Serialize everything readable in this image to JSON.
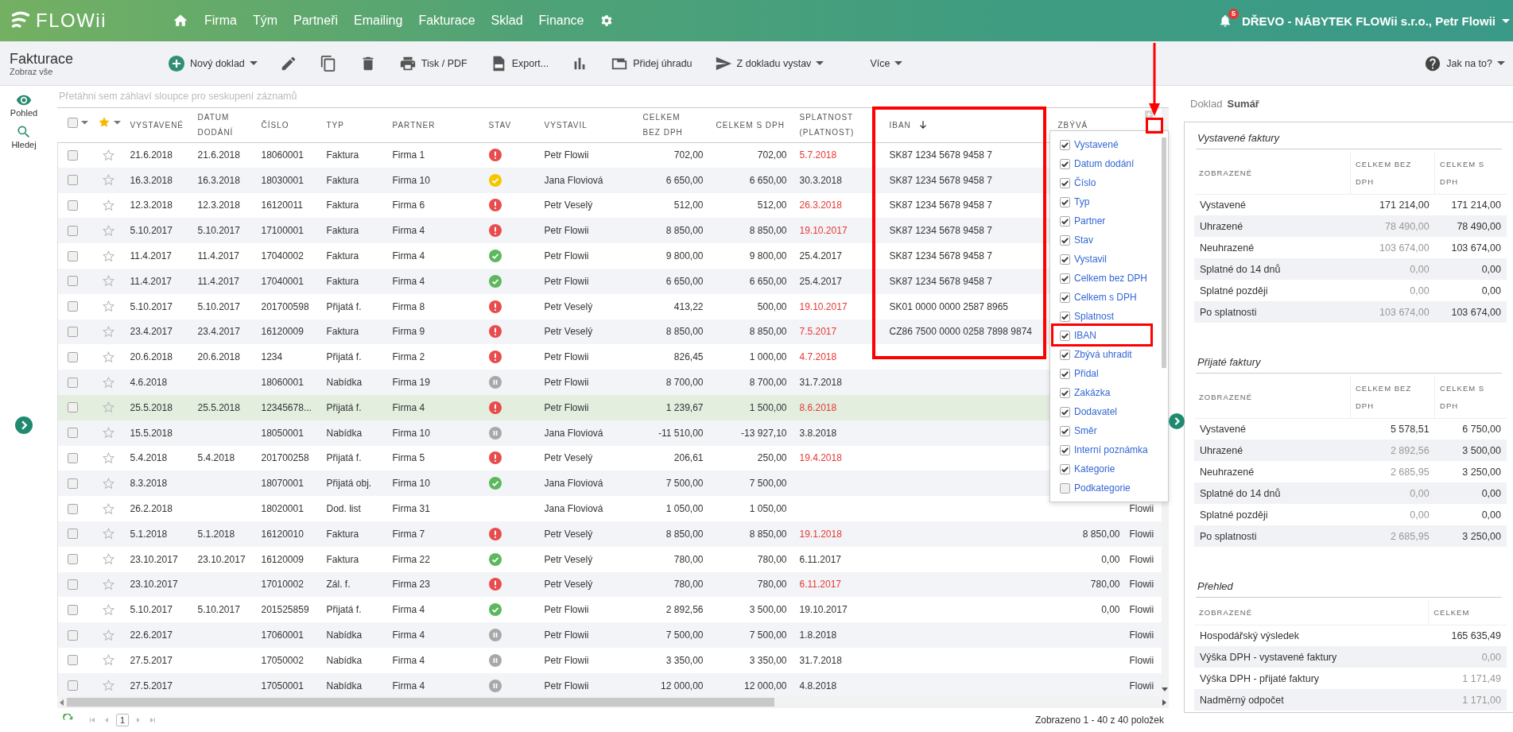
{
  "topbar": {
    "logo": "FLOWii",
    "nav": [
      "Firma",
      "Tým",
      "Partneři",
      "Emailing",
      "Fakturace",
      "Sklad",
      "Finance"
    ],
    "notifications": "5",
    "account": "DŘEVO - NÁBYTEK FLOWii s.r.o., Petr Flowii"
  },
  "toolbar": {
    "title": "Fakturace",
    "subtitle": "Zobraz vše",
    "actions": [
      {
        "kind": "new",
        "label": "Nový doklad",
        "dropdown": true
      },
      {
        "kind": "edit",
        "dropdown": false
      },
      {
        "kind": "copy",
        "dropdown": false
      },
      {
        "kind": "delete",
        "dropdown": false
      },
      {
        "kind": "print",
        "label": "Tisk / PDF",
        "dropdown": false
      },
      {
        "kind": "export",
        "label": "Export...",
        "dropdown": false
      },
      {
        "kind": "chart",
        "dropdown": false
      },
      {
        "kind": "payment",
        "label": "Přidej úhradu",
        "dropdown": false
      },
      {
        "kind": "issue",
        "label": "Z dokladu vystav",
        "dropdown": true
      },
      {
        "kind": "more",
        "label": "Více",
        "dropdown": true
      }
    ],
    "help": {
      "label": "Jak na to?",
      "dropdown": true
    }
  },
  "rail": [
    {
      "kind": "view",
      "label": "Pohled"
    },
    {
      "kind": "search",
      "label": "Hledej"
    }
  ],
  "grid": {
    "group_hint": "Přetáhni sem záhlaví sloupce pro seskupení záznamů",
    "columns": [
      {
        "kind": "check",
        "checked": false
      },
      {
        "kind": "star"
      },
      {
        "kind": "text",
        "label": "VYSTAVENÉ",
        "sorted": false
      },
      {
        "kind": "text",
        "label": "DATUM\nDODÁNÍ",
        "sorted": false
      },
      {
        "kind": "text",
        "label": "ČÍSLO",
        "sorted": false
      },
      {
        "kind": "text",
        "label": "TYP",
        "sorted": false
      },
      {
        "kind": "text",
        "label": "PARTNER",
        "sorted": false
      },
      {
        "kind": "status",
        "label": "STAV",
        "sorted": false
      },
      {
        "kind": "text",
        "label": "VYSTAVIL",
        "sorted": false
      },
      {
        "kind": "number",
        "label": "CELKEM\nBEZ DPH",
        "sorted": false
      },
      {
        "kind": "number",
        "label": "CELKEM S DPH",
        "sorted": false
      },
      {
        "kind": "due",
        "label": "SPLATNOST\n(PLATNOST)",
        "sorted": false
      },
      {
        "kind": "text",
        "label": "IBAN",
        "sorted": true
      },
      {
        "kind": "number",
        "label": "ZBÝVÁ",
        "sorted": false
      },
      {
        "kind": "text"
      }
    ],
    "rows": [
      {
        "checked": false,
        "selected": false,
        "issued": "21.6.2018",
        "delivered": "21.6.2018",
        "number": "18060001",
        "type": "Faktura",
        "partner": "Firma 1",
        "status": {
          "kind": "error"
        },
        "issued_by": "Petr Flowii",
        "net": "702,00",
        "gross": "702,00",
        "due": "5.7.2018",
        "overdue": true,
        "iban": "SK87 1234 5678 9458 7"
      },
      {
        "checked": false,
        "selected": false,
        "issued": "16.3.2018",
        "delivered": "16.3.2018",
        "number": "18030001",
        "type": "Faktura",
        "partner": "Firma 10",
        "status": {
          "kind": "partial"
        },
        "issued_by": "Jana Floviová",
        "net": "6 650,00",
        "gross": "6 650,00",
        "due": "30.3.2018",
        "overdue": false,
        "iban": "SK87 1234 5678 9458 7"
      },
      {
        "checked": false,
        "selected": false,
        "issued": "12.3.2018",
        "delivered": "12.3.2018",
        "number": "16120011",
        "type": "Faktura",
        "partner": "Firma 6",
        "status": {
          "kind": "error"
        },
        "issued_by": "Petr Veselý",
        "net": "512,00",
        "gross": "512,00",
        "due": "26.3.2018",
        "overdue": true,
        "iban": "SK87 1234 5678 9458 7"
      },
      {
        "checked": false,
        "selected": false,
        "issued": "5.10.2017",
        "delivered": "5.10.2017",
        "number": "17100001",
        "type": "Faktura",
        "partner": "Firma 4",
        "status": {
          "kind": "error"
        },
        "issued_by": "Petr Flowii",
        "net": "8 850,00",
        "gross": "8 850,00",
        "due": "19.10.2017",
        "overdue": true,
        "iban": "SK87 1234 5678 9458 7"
      },
      {
        "checked": false,
        "selected": false,
        "issued": "11.4.2017",
        "delivered": "11.4.2017",
        "number": "17040002",
        "type": "Faktura",
        "partner": "Firma 4",
        "status": {
          "kind": "paid"
        },
        "issued_by": "Petr Flowii",
        "net": "9 800,00",
        "gross": "9 800,00",
        "due": "25.4.2017",
        "overdue": false,
        "iban": "SK87 1234 5678 9458 7"
      },
      {
        "checked": false,
        "selected": false,
        "issued": "11.4.2017",
        "delivered": "11.4.2017",
        "number": "17040001",
        "type": "Faktura",
        "partner": "Firma 4",
        "status": {
          "kind": "paid"
        },
        "issued_by": "Petr Flowii",
        "net": "6 650,00",
        "gross": "6 650,00",
        "due": "25.4.2017",
        "overdue": false,
        "iban": "SK87 1234 5678 9458 7"
      },
      {
        "checked": false,
        "selected": false,
        "issued": "5.10.2017",
        "delivered": "5.10.2017",
        "number": "201700598",
        "type": "Přijatá f.",
        "partner": "Firma 8",
        "status": {
          "kind": "error"
        },
        "issued_by": "Petr Veselý",
        "net": "413,22",
        "gross": "500,00",
        "due": "19.10.2017",
        "overdue": true,
        "iban": "SK01 0000 0000 2587 8965"
      },
      {
        "checked": false,
        "selected": false,
        "issued": "23.4.2017",
        "delivered": "23.4.2017",
        "number": "16120009",
        "type": "Faktura",
        "partner": "Firma 9",
        "status": {
          "kind": "error"
        },
        "issued_by": "Petr Veselý",
        "net": "8 850,00",
        "gross": "8 850,00",
        "due": "7.5.2017",
        "overdue": true,
        "iban": "CZ86 7500 0000 0258 7898 9874"
      },
      {
        "checked": false,
        "selected": false,
        "issued": "20.6.2018",
        "delivered": "20.6.2018",
        "number": "1234",
        "type": "Přijatá f.",
        "partner": "Firma 2",
        "status": {
          "kind": "error"
        },
        "issued_by": "Petr Flowii",
        "net": "826,45",
        "gross": "1 000,00",
        "due": "4.7.2018",
        "overdue": true
      },
      {
        "checked": false,
        "selected": false,
        "issued": "4.6.2018",
        "number": "18060001",
        "type": "Nabídka",
        "partner": "Firma 19",
        "status": {
          "kind": "paused"
        },
        "issued_by": "Petr Flowii",
        "net": "8 700,00",
        "gross": "8 700,00",
        "due": "31.7.2018",
        "overdue": false
      },
      {
        "checked": false,
        "selected": true,
        "issued": "25.5.2018",
        "delivered": "25.5.2018",
        "number": "12345678...",
        "type": "Přijatá f.",
        "partner": "Firma 4",
        "status": {
          "kind": "error"
        },
        "issued_by": "Petr Flowii",
        "net": "1 239,67",
        "gross": "1 500,00",
        "due": "8.6.2018",
        "overdue": true
      },
      {
        "checked": false,
        "selected": false,
        "issued": "15.5.2018",
        "number": "18050001",
        "type": "Nabídka",
        "partner": "Firma 10",
        "status": {
          "kind": "paused"
        },
        "issued_by": "Jana Floviová",
        "net": "-11 510,00",
        "gross": "-13 927,10",
        "due": "3.8.2018",
        "overdue": false
      },
      {
        "checked": false,
        "selected": false,
        "issued": "5.4.2018",
        "delivered": "5.4.2018",
        "number": "201700258",
        "type": "Přijatá f.",
        "partner": "Firma 5",
        "status": {
          "kind": "error"
        },
        "issued_by": "Petr Veselý",
        "net": "206,61",
        "gross": "250,00",
        "due": "19.4.2018",
        "overdue": true
      },
      {
        "checked": false,
        "selected": false,
        "issued": "8.3.2018",
        "number": "18070001",
        "type": "Přijatá obj.",
        "partner": "Firma 10",
        "status": {
          "kind": "paid"
        },
        "issued_by": "Jana Floviová",
        "net": "7 500,00",
        "gross": "7 500,00"
      },
      {
        "checked": false,
        "selected": false,
        "issued": "26.2.2018",
        "number": "18020001",
        "type": "Dod. list",
        "partner": "Firma 31",
        "issued_by": "Jana Floviová",
        "net": "1 050,00",
        "gross": "1 050,00",
        "added_by": "Flowii"
      },
      {
        "checked": false,
        "selected": false,
        "issued": "5.1.2018",
        "delivered": "5.1.2018",
        "number": "16120010",
        "type": "Faktura",
        "partner": "Firma 7",
        "status": {
          "kind": "error"
        },
        "issued_by": "Petr Veselý",
        "net": "8 850,00",
        "gross": "8 850,00",
        "due": "19.1.2018",
        "overdue": true,
        "remaining": "8 850,00",
        "added_by": "Flowii"
      },
      {
        "checked": false,
        "selected": false,
        "issued": "23.10.2017",
        "delivered": "23.10.2017",
        "number": "16120009",
        "type": "Faktura",
        "partner": "Firma 22",
        "status": {
          "kind": "paid"
        },
        "issued_by": "Petr Veselý",
        "net": "780,00",
        "gross": "780,00",
        "due": "6.11.2017",
        "overdue": false,
        "remaining": "0,00",
        "added_by": "Flowii"
      },
      {
        "checked": false,
        "selected": false,
        "issued": "23.10.2017",
        "number": "17010002",
        "type": "Zál. f.",
        "partner": "Firma 23",
        "status": {
          "kind": "error"
        },
        "issued_by": "Petr Veselý",
        "net": "780,00",
        "gross": "780,00",
        "due": "6.11.2017",
        "overdue": true,
        "remaining": "780,00",
        "added_by": "Flowii"
      },
      {
        "checked": false,
        "selected": false,
        "issued": "5.10.2017",
        "delivered": "5.10.2017",
        "number": "201525859",
        "type": "Přijatá f.",
        "partner": "Firma 4",
        "status": {
          "kind": "paid"
        },
        "issued_by": "Petr Flowii",
        "net": "2 892,56",
        "gross": "3 500,00",
        "due": "19.10.2017",
        "overdue": false,
        "remaining": "0,00",
        "added_by": "Flowii"
      },
      {
        "checked": false,
        "selected": false,
        "issued": "22.6.2017",
        "number": "17060001",
        "type": "Nabídka",
        "partner": "Firma 4",
        "status": {
          "kind": "paused"
        },
        "issued_by": "Petr Flowii",
        "net": "7 500,00",
        "gross": "7 500,00",
        "due": "1.8.2018",
        "overdue": false,
        "added_by": "Flowii"
      },
      {
        "checked": false,
        "selected": false,
        "issued": "27.5.2017",
        "number": "17050002",
        "type": "Nabídka",
        "partner": "Firma 4",
        "status": {
          "kind": "paused"
        },
        "issued_by": "Petr Flowii",
        "net": "3 350,00",
        "gross": "3 350,00",
        "due": "31.7.2018",
        "overdue": false,
        "added_by": "Flowii"
      },
      {
        "checked": false,
        "selected": false,
        "issued": "27.5.2017",
        "number": "17050001",
        "type": "Nabídka",
        "partner": "Firma 4",
        "status": {
          "kind": "paused"
        },
        "issued_by": "Petr Flowii",
        "net": "12 000,00",
        "gross": "12 000,00",
        "due": "4.8.2018",
        "overdue": false,
        "added_by": "Flowii"
      }
    ],
    "footer": {
      "page": "1",
      "info": "Zobrazeno 1 - 40 z 40 položek"
    }
  },
  "column_picker": {
    "items": [
      {
        "label": "Vystavené",
        "checked": true
      },
      {
        "label": "Datum dodání",
        "checked": true
      },
      {
        "label": "Číslo",
        "checked": true
      },
      {
        "label": "Typ",
        "checked": true
      },
      {
        "label": "Partner",
        "checked": true
      },
      {
        "label": "Stav",
        "checked": true
      },
      {
        "label": "Vystavil",
        "checked": true
      },
      {
        "label": "Celkem bez DPH",
        "checked": true
      },
      {
        "label": "Celkem s DPH",
        "checked": true
      },
      {
        "label": "Splatnost",
        "checked": true
      },
      {
        "label": "IBAN",
        "checked": true
      },
      {
        "label": "Zbývá uhradit",
        "checked": true
      },
      {
        "label": "Přidal",
        "checked": true
      },
      {
        "label": "Zakázka",
        "checked": true
      },
      {
        "label": "Dodavatel",
        "checked": true
      },
      {
        "label": "Směr",
        "checked": true
      },
      {
        "label": "Interní poznámka",
        "checked": true
      },
      {
        "label": "Kategorie",
        "checked": true
      },
      {
        "label": "Podkategorie",
        "checked": false
      }
    ]
  },
  "summary": {
    "tabs": [
      {
        "label": "Doklad",
        "selected": false
      },
      {
        "label": "Sumář",
        "selected": true
      }
    ],
    "sections": [
      {
        "title": "Vystavené faktury",
        "columns": [
          "ZOBRAZENÉ",
          "CELKEM BEZ\nDPH",
          "CELKEM S\nDPH"
        ],
        "rows": [
          {
            "label": "Vystavené",
            "values": [
              "171 214,00",
              "171 214,00"
            ],
            "muted": false
          },
          {
            "label": "Uhrazené",
            "values": [
              "78 490,00",
              "78 490,00"
            ],
            "muted": true
          },
          {
            "label": "Neuhrazené",
            "values": [
              "103 674,00",
              "103 674,00"
            ],
            "muted": true
          },
          {
            "label": "Splatné do 14 dnů",
            "values": [
              "0,00",
              "0,00"
            ],
            "muted": true
          },
          {
            "label": "Splatné později",
            "values": [
              "0,00",
              "0,00"
            ],
            "muted": true
          },
          {
            "label": "Po splatnosti",
            "values": [
              "103 674,00",
              "103 674,00"
            ],
            "muted": true
          }
        ]
      },
      {
        "title": "Přijaté faktury",
        "columns": [
          "ZOBRAZENÉ",
          "CELKEM BEZ\nDPH",
          "CELKEM S\nDPH"
        ],
        "rows": [
          {
            "label": "Vystavené",
            "values": [
              "5 578,51",
              "6 750,00"
            ],
            "muted": false
          },
          {
            "label": "Uhrazené",
            "values": [
              "2 892,56",
              "3 500,00"
            ],
            "muted": true
          },
          {
            "label": "Neuhrazené",
            "values": [
              "2 685,95",
              "3 250,00"
            ],
            "muted": true
          },
          {
            "label": "Splatné do 14 dnů",
            "values": [
              "0,00",
              "0,00"
            ],
            "muted": true
          },
          {
            "label": "Splatné později",
            "values": [
              "0,00",
              "0,00"
            ],
            "muted": true
          },
          {
            "label": "Po splatnosti",
            "values": [
              "2 685,95",
              "3 250,00"
            ],
            "muted": true
          }
        ]
      },
      {
        "title": "Přehled",
        "columns": [
          "ZOBRAZENÉ",
          "CELKEM"
        ],
        "rows": [
          {
            "label": "Hospodářský výsledek",
            "values": [
              "165 635,49"
            ],
            "muted": false
          },
          {
            "label": "Výška DPH - vystavené faktury",
            "values": [
              "0,00"
            ],
            "muted": true
          },
          {
            "label": "Výška DPH - přijaté faktury",
            "values": [
              "1 171,49"
            ],
            "muted": true
          },
          {
            "label": "Nadměrný odpočet",
            "values": [
              "1 171,00"
            ],
            "muted": true
          }
        ]
      }
    ]
  }
}
